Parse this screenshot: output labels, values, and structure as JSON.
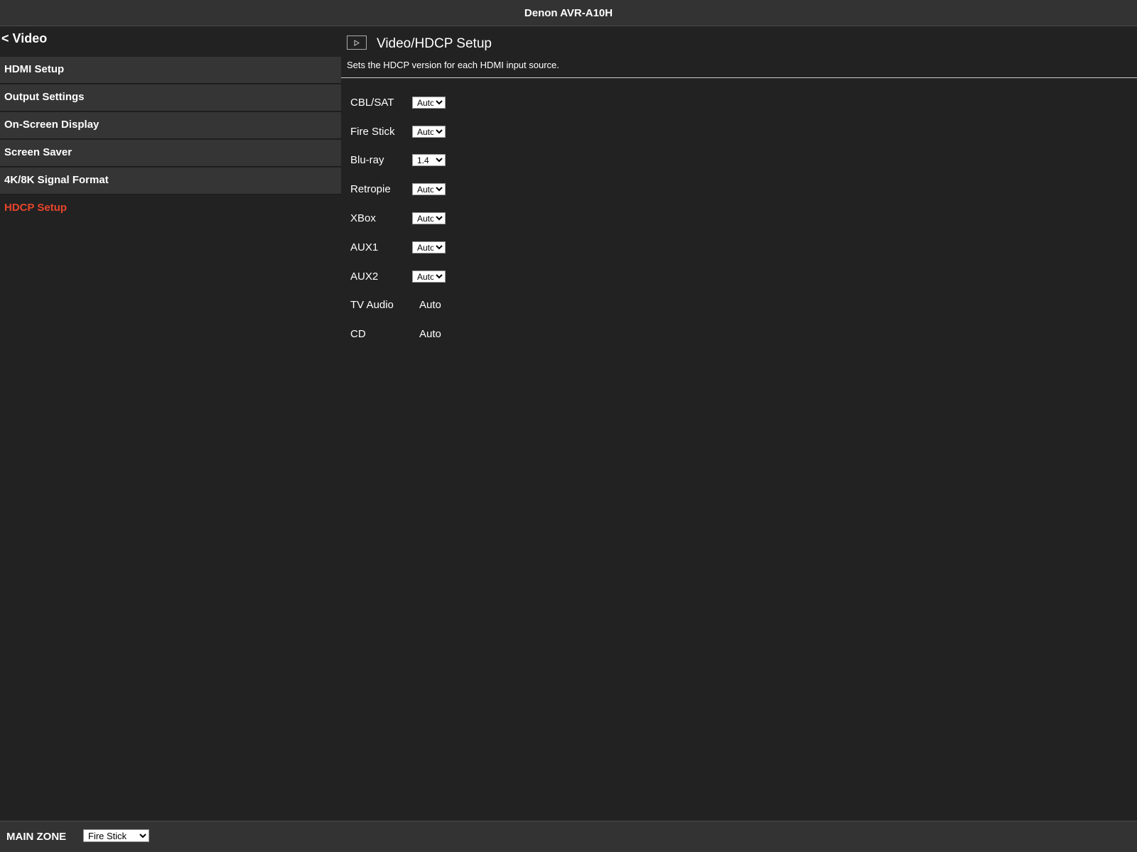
{
  "topbar": {
    "title": "Denon AVR-A10H"
  },
  "sidebar": {
    "back_label": "< Video",
    "items": [
      {
        "label": "HDMI Setup",
        "active": false
      },
      {
        "label": "Output Settings",
        "active": false
      },
      {
        "label": "On-Screen Display",
        "active": false
      },
      {
        "label": "Screen Saver",
        "active": false
      },
      {
        "label": "4K/8K Signal Format",
        "active": false
      },
      {
        "label": "HDCP Setup",
        "active": true
      }
    ]
  },
  "content": {
    "title": "Video/HDCP Setup",
    "description": "Sets the HDCP version for each HDMI input source.",
    "rows": [
      {
        "label": "CBL/SAT",
        "value": "Auto",
        "editable": true
      },
      {
        "label": "Fire Stick",
        "value": "Auto",
        "editable": true
      },
      {
        "label": "Blu-ray",
        "value": "1.4",
        "editable": true
      },
      {
        "label": "Retropie",
        "value": "Auto",
        "editable": true
      },
      {
        "label": "XBox",
        "value": "Auto",
        "editable": true
      },
      {
        "label": "AUX1",
        "value": "Auto",
        "editable": true
      },
      {
        "label": "AUX2",
        "value": "Auto",
        "editable": true
      },
      {
        "label": "TV Audio",
        "value": "Auto",
        "editable": false
      },
      {
        "label": "CD",
        "value": "Auto",
        "editable": false
      }
    ]
  },
  "bottombar": {
    "zone_label": "MAIN ZONE",
    "source_value": "Fire Stick"
  },
  "icons": {
    "header_icon": "play-icon",
    "accent_color": "#e8452c"
  }
}
